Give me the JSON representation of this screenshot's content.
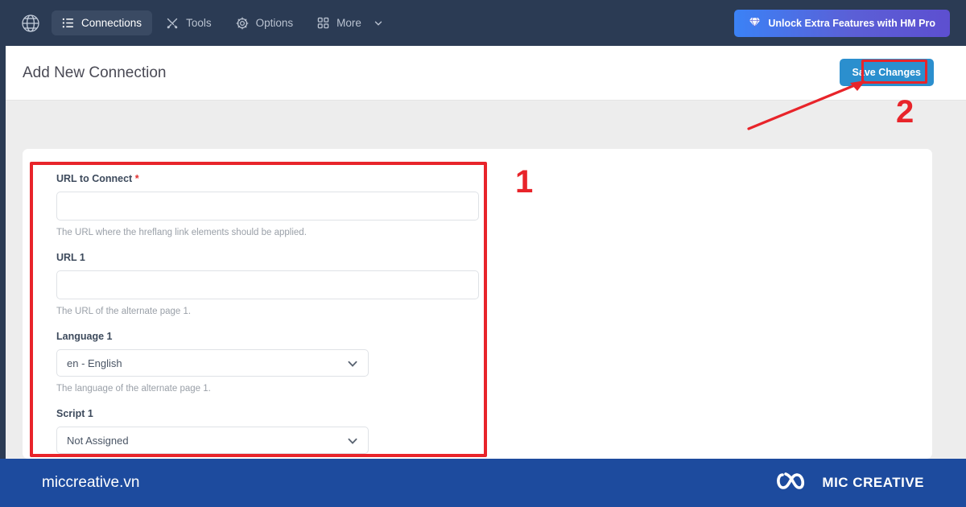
{
  "topnav": {
    "logo_icon": "globe-icon",
    "items": [
      {
        "label": "Connections",
        "icon": "list-icon",
        "active": true
      },
      {
        "label": "Tools",
        "icon": "tools-icon",
        "active": false
      },
      {
        "label": "Options",
        "icon": "gear-icon",
        "active": false
      },
      {
        "label": "More",
        "icon": "grid-icon",
        "active": false,
        "has_chevron": true
      }
    ],
    "pro_button": {
      "label": "Unlock Extra Features with HM Pro",
      "icon": "diamond-icon"
    },
    "background_color": "#2b3b54",
    "active_item_color": "#3a4a63"
  },
  "subheader": {
    "title": "Add New Connection",
    "save_button": {
      "label": "Save Changes",
      "color": "#2b8fce"
    }
  },
  "form": {
    "fields": [
      {
        "label": "URL to Connect",
        "required": true,
        "required_mark": "*",
        "type": "text",
        "value": "",
        "helper": "The URL where the hreflang link elements should be applied."
      },
      {
        "label": "URL 1",
        "required": false,
        "type": "text",
        "value": "",
        "helper": "The URL of the alternate page 1."
      },
      {
        "label": "Language 1",
        "required": false,
        "type": "select",
        "value": "en - English",
        "helper": "The language of the alternate page 1."
      },
      {
        "label": "Script 1",
        "required": false,
        "type": "select",
        "value": "Not Assigned",
        "helper": ""
      }
    ]
  },
  "annotations": {
    "marker_1": "1",
    "marker_2": "2",
    "color": "#e8242a"
  },
  "footer": {
    "site": "miccreative.vn",
    "brand": "MIC CREATIVE",
    "logo_icon": "infinity-loop-logo",
    "background_color": "#1d4b9e"
  }
}
